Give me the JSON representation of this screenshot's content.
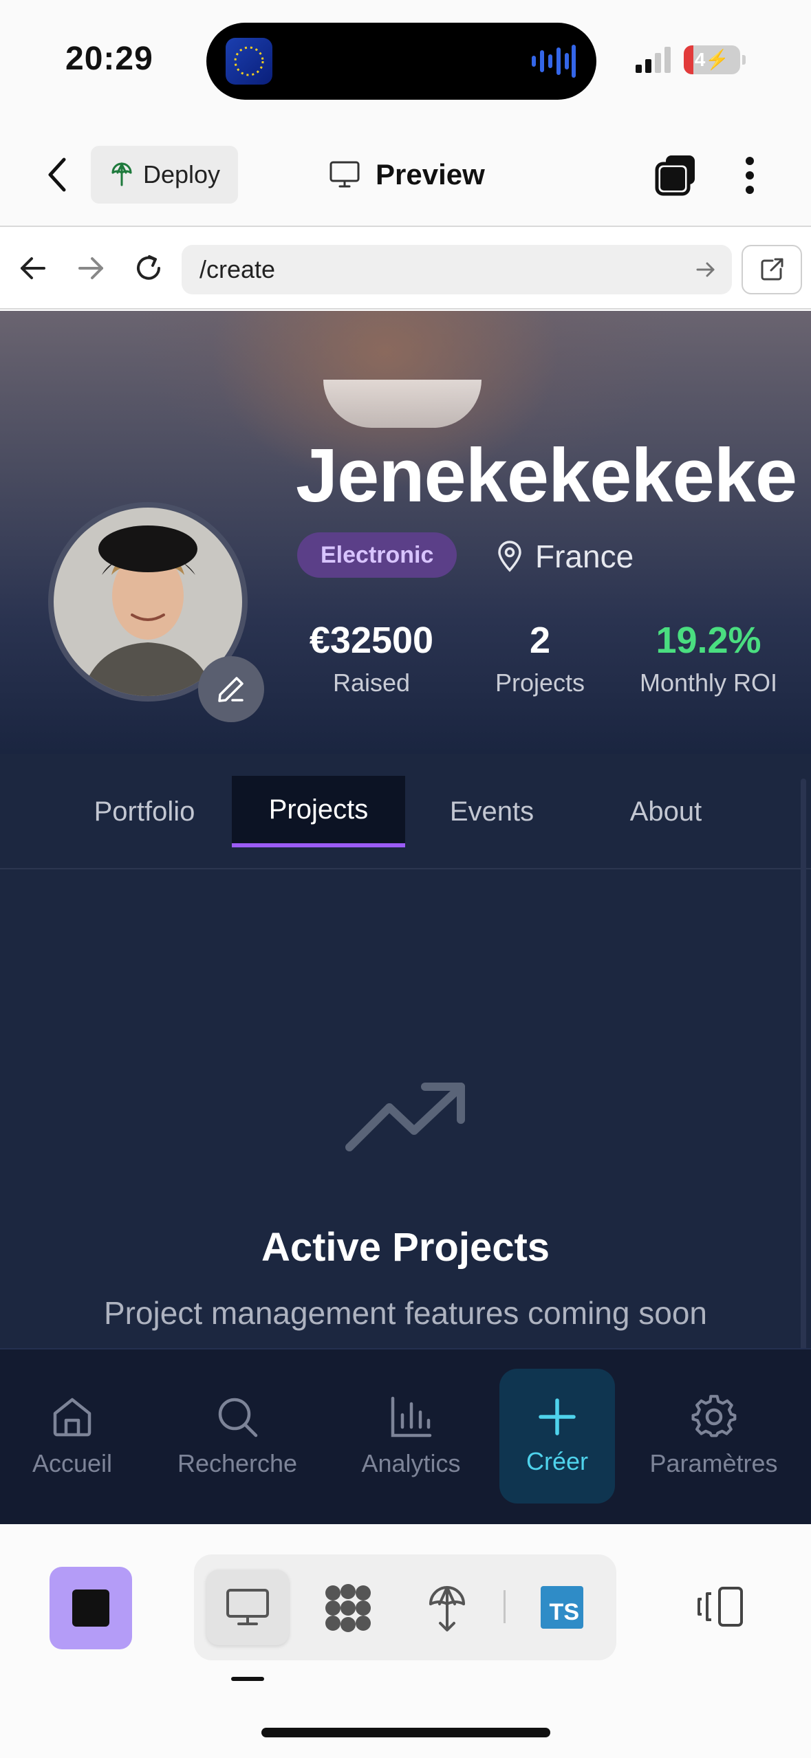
{
  "status_bar": {
    "time": "20:29",
    "battery": "4"
  },
  "header": {
    "deploy_label": "Deploy",
    "preview_label": "Preview"
  },
  "browser": {
    "url": "/create"
  },
  "profile": {
    "name": "Jenekekekeke",
    "genre": "Electronic",
    "location": "France",
    "stats": [
      {
        "value": "€32500",
        "label": "Raised"
      },
      {
        "value": "2",
        "label": "Projects"
      },
      {
        "value": "19.2%",
        "label": "Monthly ROI",
        "color": "#4ade80"
      }
    ]
  },
  "tabs": [
    {
      "label": "Portfolio"
    },
    {
      "label": "Projects",
      "active": true
    },
    {
      "label": "Events"
    },
    {
      "label": "About"
    }
  ],
  "empty_state": {
    "icon": "trending-up-icon",
    "title": "Active Projects",
    "subtitle": "Project management features coming soon"
  },
  "app_nav": [
    {
      "label": "Accueil",
      "icon": "home-icon"
    },
    {
      "label": "Recherche",
      "icon": "search-icon"
    },
    {
      "label": "Analytics",
      "icon": "bar-chart-icon"
    },
    {
      "label": "Créer",
      "icon": "plus-icon",
      "active": true
    },
    {
      "label": "Paramètres",
      "icon": "gear-icon"
    }
  ],
  "toolbar": {
    "ts_label": "TS"
  },
  "colors": {
    "accent": "#9b5cf5",
    "create_accent": "#4fd3ec",
    "roi_green": "#4ade80",
    "page_bg": "#1c2740"
  }
}
